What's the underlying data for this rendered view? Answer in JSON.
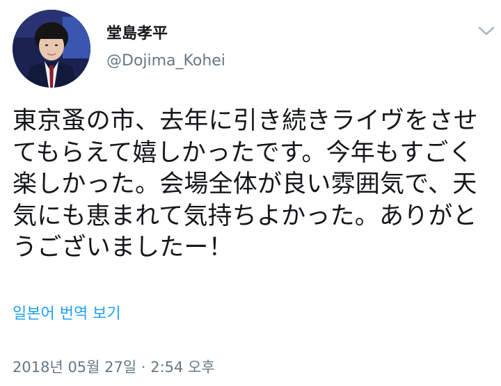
{
  "author": {
    "display_name": "堂島孝平",
    "handle": "@Dojima_Kohei"
  },
  "tweet": {
    "text": "東京蚤の市、去年に引き続きライヴをさせ\nてもらえて嬉しかったです。今年もすごく\n楽しかった。会場全体が良い雰囲気で、天\n気にも恵まれて気持ちよかった。ありがと\nうございましたー！",
    "translate_label": "일본어 번역 보기",
    "timestamp": "2018년 05월 27일 · 2:54 오후"
  },
  "icons": {
    "menu": "chevron-down-icon",
    "avatar": "profile-photo"
  }
}
